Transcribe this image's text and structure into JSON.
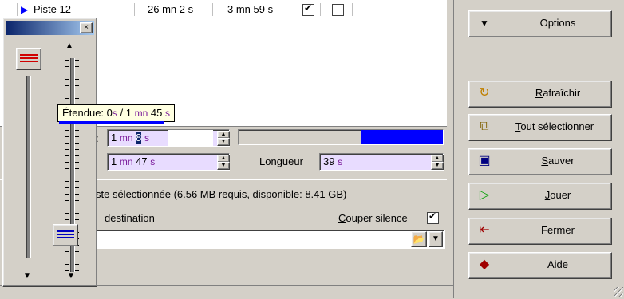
{
  "track_row": {
    "name": "Piste 12",
    "duration1": "26 mn 2 s",
    "duration2": "3 mn 59 s",
    "check1": true,
    "check2": false
  },
  "tooltip": {
    "prefix": "Étendue: 0",
    "s1": "s",
    "sep": "/ 1",
    "mn": "mn",
    "val": "45",
    "s2": "s"
  },
  "fields": {
    "start": {
      "mn_val": "1",
      "mn": "mn",
      "sec_val": "8",
      "s": "s"
    },
    "end": {
      "mn_val": "1",
      "mn": "mn",
      "sec_val": "47",
      "s": "s"
    },
    "length_label": "Longueur",
    "length": {
      "val": "39",
      "s": "s"
    },
    "start_label_fragment": ":"
  },
  "progress": {
    "fraction": 0.6
  },
  "status_text": "ste sélectionnée (6.56 MB requis, disponible: 8.41 GB)",
  "destination_label": "destination",
  "couper_silence": {
    "label_u": "C",
    "label_rest": "ouper silence",
    "checked": true
  },
  "buttons": {
    "options": "Options",
    "rafraichir_u": "R",
    "rafraichir_rest": "afraîchir",
    "tout_u": "T",
    "tout_rest": "out sélectionner",
    "sauver_u": "S",
    "sauver_rest": "auver",
    "jouer_u": "J",
    "jouer_rest": "ouer",
    "fermer": "Fermer",
    "aide_u": "A",
    "aide_rest": "ide"
  },
  "slider_panel": {
    "close": "×"
  },
  "colors": {
    "accent": "#0000ff",
    "purple": "#7a1a9a",
    "field_bg": "#e8dcff",
    "tooltip_bg": "#ffffe1"
  },
  "icons": [
    "play-arrow-icon",
    "checkbox-icon",
    "refresh-icon",
    "select-all-icon",
    "save-icon",
    "play-icon",
    "exit-icon",
    "help-book-icon",
    "folder-open-icon",
    "dropdown-arrow-icon",
    "close-icon"
  ]
}
